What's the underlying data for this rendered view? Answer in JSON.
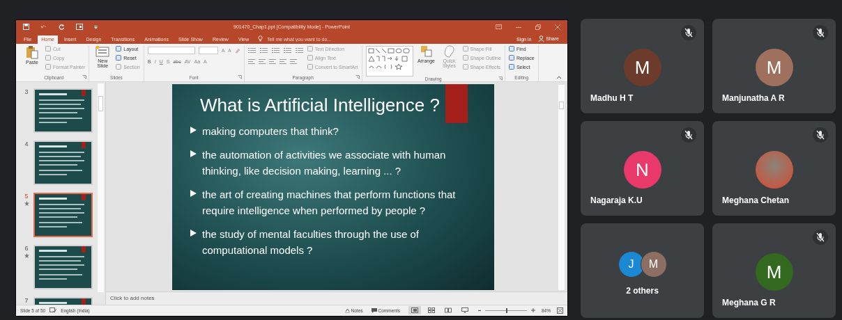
{
  "powerpoint": {
    "title": "901470_Chap1.ppt [Compatibility Mode] - PowerPoint",
    "tabs": [
      {
        "label": "File",
        "selected": false
      },
      {
        "label": "Home",
        "selected": true
      },
      {
        "label": "Insert",
        "selected": false
      },
      {
        "label": "Design",
        "selected": false
      },
      {
        "label": "Transitions",
        "selected": false
      },
      {
        "label": "Animations",
        "selected": false
      },
      {
        "label": "Slide Show",
        "selected": false
      },
      {
        "label": "Review",
        "selected": false
      },
      {
        "label": "View",
        "selected": false
      }
    ],
    "tell_me": {
      "placeholder": "Tell me what you want to do..."
    },
    "sign_in": "Sign in",
    "share": "Share",
    "ribbon_groups": [
      {
        "label": "Clipboard",
        "launcher": true,
        "items": [
          {
            "kind": "large",
            "label": "Paste",
            "disabled": false
          },
          {
            "kind": "stack",
            "entries": [
              {
                "label": "Cut",
                "disabled": true
              },
              {
                "label": "Copy",
                "disabled": true
              },
              {
                "label": "Format Painter",
                "disabled": true
              }
            ]
          }
        ]
      },
      {
        "label": "Slides",
        "launcher": false,
        "items": [
          {
            "kind": "large",
            "label": "New Slide",
            "disabled": false
          },
          {
            "kind": "stack",
            "entries": [
              {
                "label": "Layout",
                "disabled": false
              },
              {
                "label": "Reset",
                "disabled": false
              },
              {
                "label": "Section",
                "disabled": true
              }
            ]
          }
        ]
      },
      {
        "label": "Font",
        "launcher": true,
        "items": [
          {
            "kind": "font",
            "row1": [
              "A",
              "A"
            ],
            "row2": [
              "B",
              "I",
              "U",
              "S",
              "abc",
              "AV",
              "Aa",
              "A"
            ]
          }
        ]
      },
      {
        "label": "Paragraph",
        "launcher": true,
        "items": [
          {
            "kind": "paragraph"
          },
          {
            "kind": "stack",
            "entries": [
              {
                "label": "Text Direction",
                "disabled": true
              },
              {
                "label": "Align Text",
                "disabled": true
              },
              {
                "label": "Convert to SmartArt",
                "disabled": true
              }
            ]
          }
        ]
      },
      {
        "label": "Drawing",
        "launcher": true,
        "items": [
          {
            "kind": "shapes"
          },
          {
            "kind": "large",
            "label": "Arrange",
            "disabled": false
          },
          {
            "kind": "large",
            "label": "Quick Styles",
            "disabled": true
          },
          {
            "kind": "stack",
            "entries": [
              {
                "label": "Shape Fill",
                "disabled": true
              },
              {
                "label": "Shape Outline",
                "disabled": true
              },
              {
                "label": "Shape Effects",
                "disabled": true
              }
            ]
          }
        ]
      },
      {
        "label": "Editing",
        "launcher": false,
        "items": [
          {
            "kind": "stack",
            "entries": [
              {
                "label": "Find",
                "disabled": false
              },
              {
                "label": "Replace",
                "disabled": false
              },
              {
                "label": "Select",
                "disabled": false
              }
            ]
          }
        ]
      }
    ],
    "thumbnails": [
      {
        "number": "3",
        "animated": false,
        "selected": false
      },
      {
        "number": "4",
        "animated": false,
        "selected": false
      },
      {
        "number": "5",
        "animated": true,
        "selected": true
      },
      {
        "number": "6",
        "animated": true,
        "selected": false
      },
      {
        "number": "7",
        "animated": false,
        "selected": false
      }
    ],
    "slide": {
      "title": "What is Artificial Intelligence ?",
      "bullets": [
        "making computers that think?",
        "the automation of activities we associate with human thinking, like decision making, learning ... ?",
        "the art of creating machines that perform functions that require intelligence when performed by people ?",
        "the study of mental faculties through the use of computational models ?"
      ]
    },
    "notes": {
      "placeholder": "Click to add notes"
    },
    "status_bar": {
      "slide_info": "Slide 5 of 50",
      "language": "English (India)",
      "notes": "Notes",
      "comments": "Comments",
      "views": [
        {
          "selected": true
        },
        {
          "selected": false
        },
        {
          "selected": false
        },
        {
          "selected": false
        }
      ],
      "zoom": {
        "level": 0.5,
        "reading": "84%"
      }
    }
  },
  "participants": [
    {
      "kind": "initial",
      "name": "Madhu H T",
      "initial": "M",
      "color": "#6d3b2c",
      "muted": true
    },
    {
      "kind": "initial",
      "name": "Manjunatha A R",
      "initial": "M",
      "color": "#a0705f",
      "muted": true
    },
    {
      "kind": "initial",
      "name": "Nagaraja K.U",
      "initial": "N",
      "color": "#e8396a",
      "muted": true
    },
    {
      "kind": "photo",
      "name": "Meghana Chetan",
      "muted": true
    },
    {
      "kind": "group",
      "label": "2 others",
      "muted": false,
      "avatars": [
        {
          "initial": "J",
          "color": "#1a88d3"
        },
        {
          "initial": "M",
          "color": "#8d6e63"
        }
      ]
    },
    {
      "kind": "initial",
      "name": "Meghana G R",
      "initial": "M",
      "color": "#33691e",
      "muted": true
    }
  ]
}
